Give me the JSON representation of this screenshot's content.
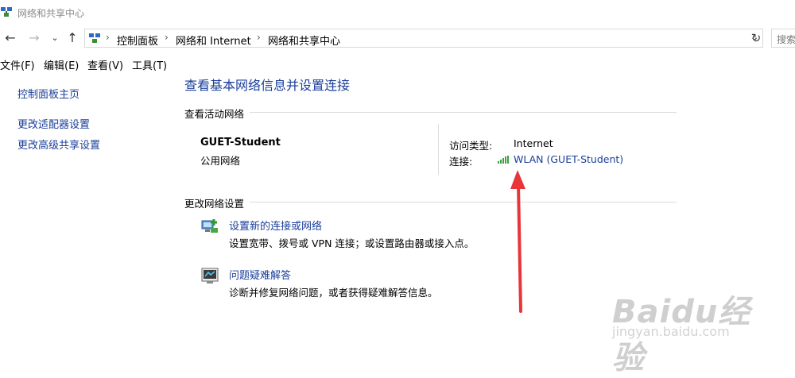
{
  "window": {
    "title": "网络和共享中心"
  },
  "address": {
    "crumbs": [
      "控制面板",
      "网络和 Internet",
      "网络和共享中心"
    ],
    "search_placeholder": "搜索"
  },
  "menu": [
    "文件(F)",
    "编辑(E)",
    "查看(V)",
    "工具(T)"
  ],
  "sidebar": [
    "控制面板主页",
    "更改适配器设置",
    "更改高级共享设置"
  ],
  "main": {
    "title": "查看基本网络信息并设置连接",
    "active_section": "查看活动网络",
    "network": {
      "name": "GUET-Student",
      "type": "公用网络",
      "access_label": "访问类型:",
      "access_value": "Internet",
      "conn_label": "连接:",
      "conn_value": "WLAN (GUET-Student)"
    },
    "change_section": "更改网络设置",
    "tasks": [
      {
        "title": "设置新的连接或网络",
        "desc": "设置宽带、拨号或 VPN 连接；或设置路由器或接入点。"
      },
      {
        "title": "问题疑难解答",
        "desc": "诊断并修复网络问题，或者获得疑难解答信息。"
      }
    ]
  },
  "watermark": {
    "brand": "Baidu经验",
    "url": "jingyan.baidu.com"
  },
  "colors": {
    "link": "#1a3e9a",
    "annotation_arrow": "#e8353a"
  }
}
